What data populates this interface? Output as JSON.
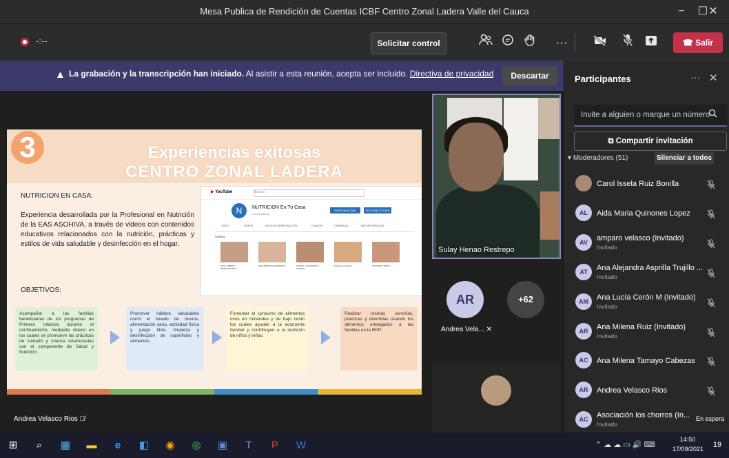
{
  "window": {
    "title": "Mesa Publica de Rendición de Cuentas ICBF Centro Zonal Ladera Valle del Cauca",
    "minimize": "−",
    "restore": "☐",
    "close": "✕"
  },
  "meeting_bar": {
    "timer": "-:--",
    "request_control": "Solicitar control",
    "leave": "Salir",
    "more": "···"
  },
  "notification": {
    "bold": "La grabación y la transcripción han iniciado.",
    "text": "Al asistir a esta reunión, acepta ser incluido.",
    "link": "Directiva de privacidad",
    "dismiss": "Descartar"
  },
  "slide": {
    "number": "3",
    "title_line1": "Experiencias exitosas",
    "title_line2": "CENTRO ZONAL LADERA",
    "heading": "NUTRICION EN CASA:",
    "paragraph": "Experiencia desarrollada por la Profesional en Nutrición de la EAS ASOHIVA, a través de videos con contenidos educativos relacionados con la nutrición, prácticas y estilos de vida saludable y desinfección en el hogar.",
    "objectives_label": "OBJETIVOS:",
    "boxes": [
      "Acompañar a las familias beneficiarias de los programas de Primera Infancia durante el confinamiento, mediante videos en los cuales se promueve las prácticas de cuidado y crianza relacionadas con el componente de Salud y Nutrición.",
      "Promover hábitos saludables como el lavado de manos, alimentación sana, actividad física y juego libre, limpieza y desinfección de superficies y alimentos.",
      "Fomentar el consumo de alimentos ricos en minerales y de bajo costo los cuales ayudan a la economía familiar y contribuyen a la nutrición de niños y niñas.",
      "Realizar recetas sencillas, prácticas y divertidas usando los alimentos entregados a las familias en la RPP."
    ],
    "youtube": {
      "logo": "YouTube",
      "search": "Buscar",
      "avatar": "N",
      "channel": "NUTRICION En Tu Casa",
      "subs": "4 suscriptores",
      "btn1": "PERSONALIZAR CANAL",
      "btn2": "YOUTUBE STUDIO",
      "tabs": [
        "INICIO",
        "VIDEOS",
        "LISTAS DE REPRODUCCIÓN",
        "CANALES",
        "COMUNIDAD",
        "MÁS INFORMACIÓN"
      ],
      "section": "Subidos",
      "captions": [
        "CASA LIMPIA Y DESINFECTADA",
        "SEGUIMIENTO DIFERENTE",
        "VIANDO, JUGUEMOS Y HIGIENE",
        "Frutas con tanduria",
        "ACTIVIDAD FISICA"
      ]
    }
  },
  "presenter_label": "Andrea Velasco Rios",
  "video": {
    "name": "Sulay Henao Restrepo"
  },
  "tiles": {
    "ar_initials": "AR",
    "ar_name": "Andrea Vela...",
    "overflow": "+62"
  },
  "panel": {
    "title": "Participantes",
    "invite_placeholder": "Invite a alguien o marque un número",
    "share_invite": "Compartir invitación",
    "moderators": "Moderadores (51)",
    "mute_all": "Silenciar a todos",
    "participants": [
      {
        "initials": "",
        "name": "Carol Issela Ruiz Bonilla",
        "sub": "",
        "photo": true
      },
      {
        "initials": "AL",
        "name": "Aida Maria Quinones Lopez",
        "sub": ""
      },
      {
        "initials": "AV",
        "name": "amparo velasco (Invitado)",
        "sub": "Invitado"
      },
      {
        "initials": "AT",
        "name": "Ana Alejandra Asprilla Trujillo ...",
        "sub": "Invitado"
      },
      {
        "initials": "AM",
        "name": "Ana Lucía Cerón M (Invitado)",
        "sub": "Invitado"
      },
      {
        "initials": "AR",
        "name": "Ana Milena Ruiz (Invitado)",
        "sub": "Invitado"
      },
      {
        "initials": "AC",
        "name": "Ana Milena Tamayo Cabezas",
        "sub": ""
      },
      {
        "initials": "AR",
        "name": "Andrea Velasco Rios",
        "sub": ""
      },
      {
        "initials": "AC",
        "name": "Asociación los chorros (In...",
        "sub": "Invitado",
        "waiting": "En espera"
      }
    ]
  },
  "taskbar": {
    "time": "14:50",
    "date": "17/09/2021",
    "notifications": "19"
  },
  "colors": {
    "accent": "#6264a7",
    "leave": "#c4314b",
    "banner": "#3b3a6b"
  }
}
